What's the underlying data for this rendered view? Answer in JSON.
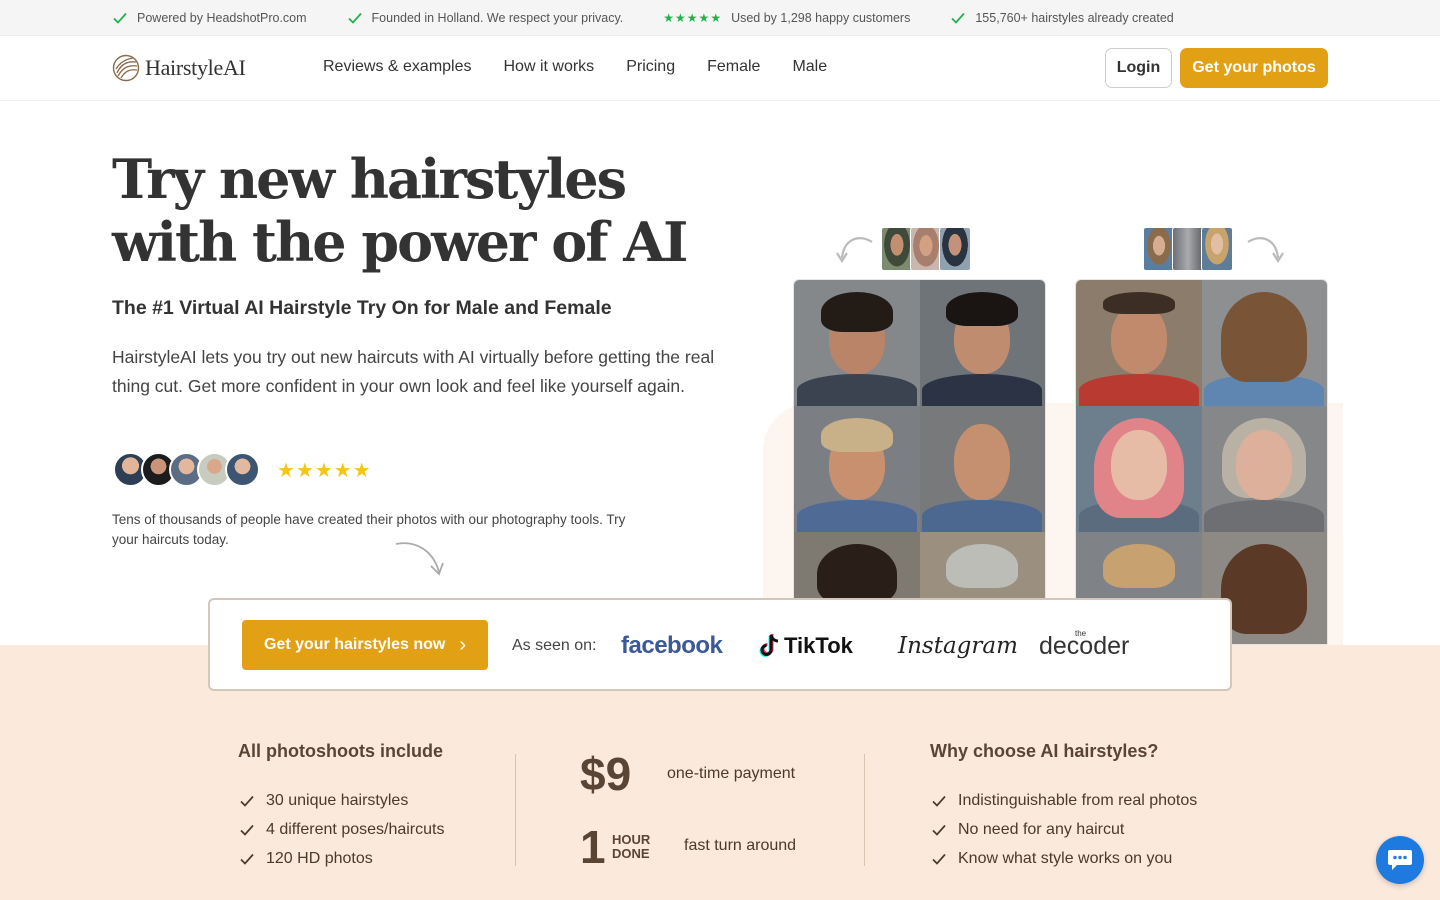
{
  "topstrip": {
    "items": [
      {
        "text": "Powered by HeadshotPro.com"
      },
      {
        "text": "Founded in Holland. We respect your privacy."
      },
      {
        "stars": "★★★★★",
        "text": "Used by 1,298 happy customers"
      },
      {
        "text": "155,760+ hairstyles already created"
      }
    ]
  },
  "nav": {
    "logo": "HairstyleAI",
    "links": [
      "Reviews & examples",
      "How it works",
      "Pricing",
      "Female",
      "Male"
    ],
    "login": "Login",
    "cta": "Get your photos"
  },
  "hero": {
    "title_line1": "Try new hairstyles",
    "title_line2": "with the power of AI",
    "subtitle": "The #1 Virtual AI Hairstyle Try On for Male and Female",
    "description": "HairstyleAI lets you try out new haircuts with AI virtually before getting the real thing cut. Get more confident in your own look and feel like yourself again.",
    "stars": "★★★★★",
    "rating": 5,
    "note": "Tens of thousands of people have created their photos with our photography tools. Try your haircuts today."
  },
  "cta_bar": {
    "button": "Get your hairstyles now",
    "button_chevron": "›",
    "seen_label": "As seen on:",
    "brands": {
      "facebook": "facebook",
      "tiktok": "TikTok",
      "instagram": "Instagram",
      "decoder_small": "the",
      "decoder": "decoder"
    }
  },
  "features": {
    "left_title": "All photoshoots include",
    "left_items": [
      "30 unique hairstyles",
      "4 different poses/haircuts",
      "120 HD photos"
    ],
    "price": "$9",
    "price_label": "one-time payment",
    "hour_number": "1",
    "hour_line1": "HOUR",
    "hour_line2": "DONE",
    "hour_label": "fast turn around",
    "right_title": "Why choose AI hairstyles?",
    "right_items": [
      "Indistinguishable from real photos",
      "No need for any haircut",
      "Know what style works on you"
    ]
  },
  "colors": {
    "accent": "#e2a115",
    "peach": "#fbe9dc",
    "brown_text": "#5a4535",
    "check_green": "#22b24c",
    "star_yellow": "#f5c518",
    "chat_blue": "#1f7ae0"
  },
  "icons": {
    "topstrip_check": "check-icon",
    "feature_check": "check-icon",
    "chat": "chat-bubble-icon",
    "logo": "hairstyleai-logo-icon",
    "tiktok": "tiktok-icon"
  }
}
